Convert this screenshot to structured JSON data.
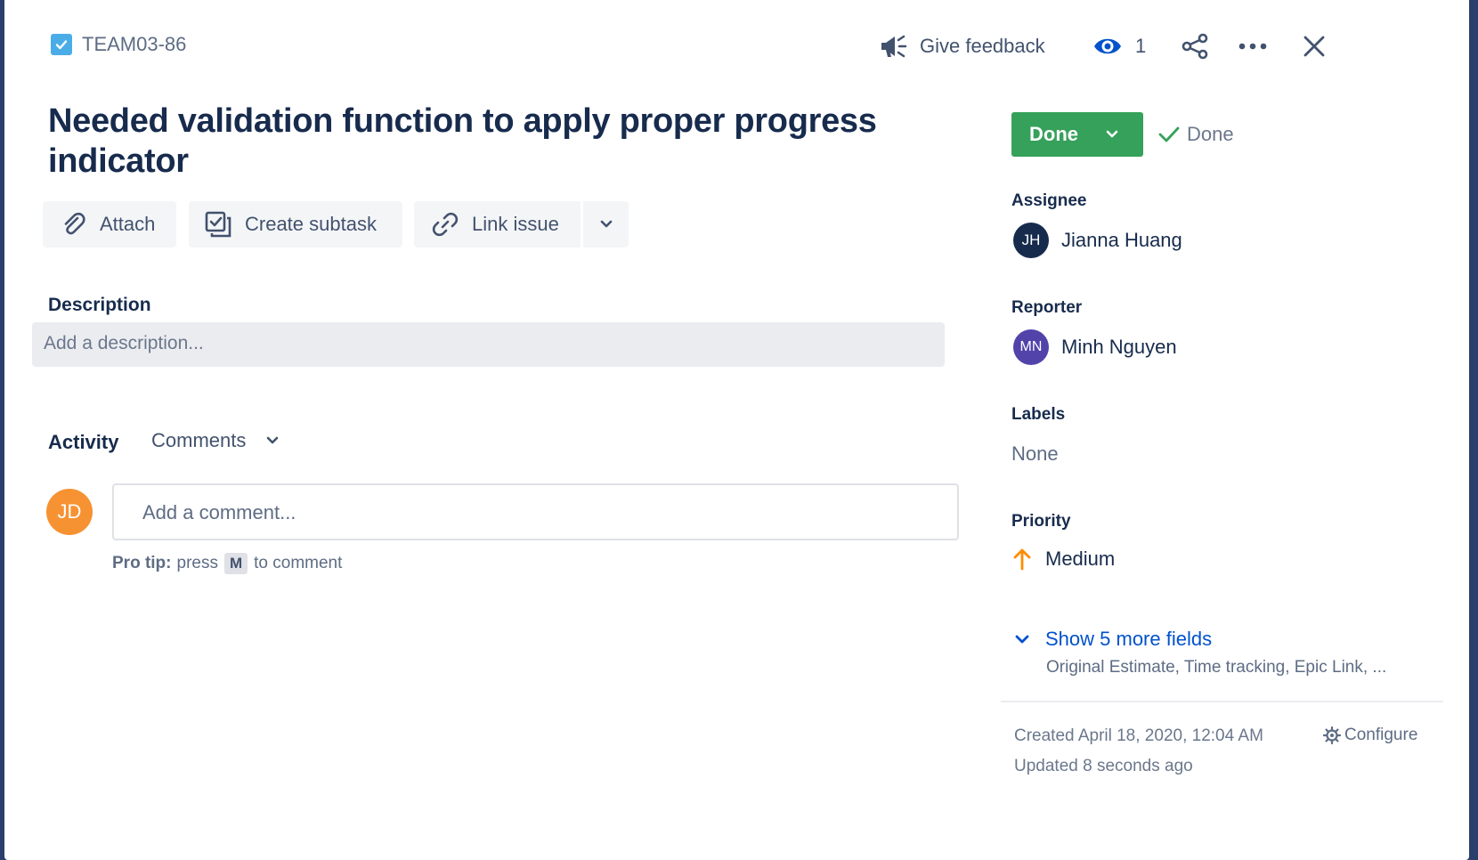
{
  "issue": {
    "key": "TEAM03-86",
    "title": "Needed validation function to apply proper progress indicator"
  },
  "header": {
    "give_feedback": "Give feedback",
    "watchers_count": "1"
  },
  "toolbar": {
    "attach": "Attach",
    "create_subtask": "Create subtask",
    "link_issue": "Link issue"
  },
  "description": {
    "label": "Description",
    "placeholder": "Add a description..."
  },
  "activity": {
    "label": "Activity",
    "filter": "Comments",
    "current_user_initials": "JD",
    "comment_placeholder": "Add a comment...",
    "protip_bold": "Pro tip:",
    "protip_press": "press",
    "protip_key": "M",
    "protip_suffix": "to comment"
  },
  "status": {
    "button_label": "Done",
    "resolution": "Done"
  },
  "fields": {
    "assignee_label": "Assignee",
    "assignee_initials": "JH",
    "assignee_name": "Jianna Huang",
    "reporter_label": "Reporter",
    "reporter_initials": "MN",
    "reporter_name": "Minh Nguyen",
    "labels_label": "Labels",
    "labels_value": "None",
    "priority_label": "Priority",
    "priority_value": "Medium",
    "show_more": "Show 5 more fields",
    "show_more_sub": "Original Estimate, Time tracking, Epic Link, ..."
  },
  "meta": {
    "created": "Created April 18, 2020, 12:04 AM",
    "updated": "Updated 8 seconds ago",
    "configure": "Configure"
  },
  "colors": {
    "status_done": "#36a15a",
    "link": "#0052cc",
    "priority_medium": "#ff8b00",
    "avatar_jd": "#f79232",
    "avatar_jh": "#172b4d",
    "avatar_mn": "#5243aa"
  }
}
